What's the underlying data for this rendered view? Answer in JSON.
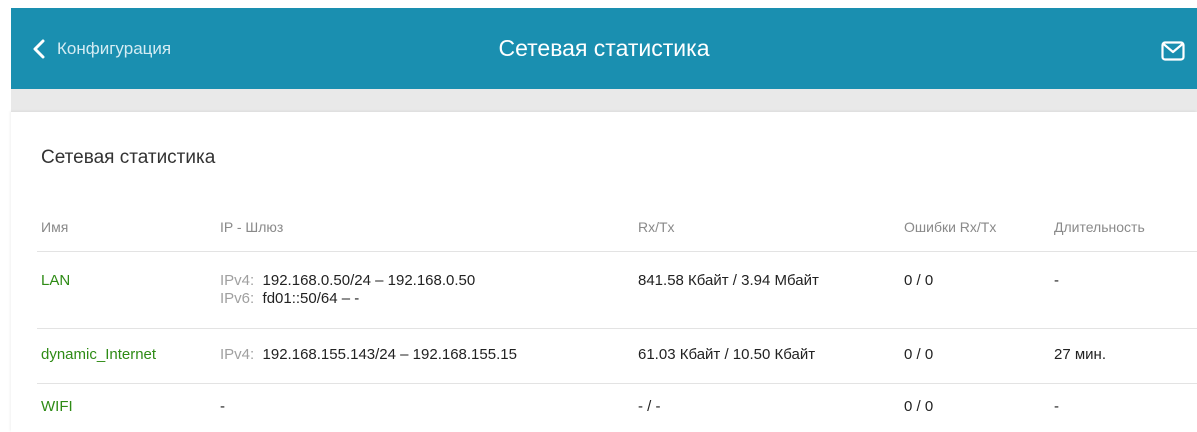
{
  "header": {
    "back_label": "Конфигурация",
    "title": "Сетевая статистика",
    "back_icon": "chevron-left-icon",
    "mail_icon": "mail-icon"
  },
  "card": {
    "title": "Сетевая статистика"
  },
  "table": {
    "columns": [
      "Имя",
      "IP - Шлюз",
      "Rx/Tx",
      "Ошибки Rx/Tx",
      "Длительность"
    ],
    "rows": [
      {
        "name": "LAN",
        "ipv4_label": "IPv4:",
        "ipv4_value": "192.168.0.50/24 – 192.168.0.50",
        "ipv6_label": "IPv6:",
        "ipv6_value": "fd01::50/64 –  -",
        "rxtx": "841.58 Кбайт / 3.94 Мбайт",
        "errors": "0 / 0",
        "duration": "-"
      },
      {
        "name": "dynamic_Internet",
        "ipv4_label": "IPv4:",
        "ipv4_value": "192.168.155.143/24 – 192.168.155.15",
        "rxtx": "61.03 Кбайт / 10.50 Кбайт",
        "errors": "0 / 0",
        "duration": "27 мин."
      },
      {
        "name": "WIFI",
        "ip": "-",
        "rxtx": "- / -",
        "errors": "0 / 0",
        "duration": "-"
      }
    ]
  },
  "colors": {
    "header_bg": "#1a8fb0",
    "link_green": "#2e8b15"
  }
}
